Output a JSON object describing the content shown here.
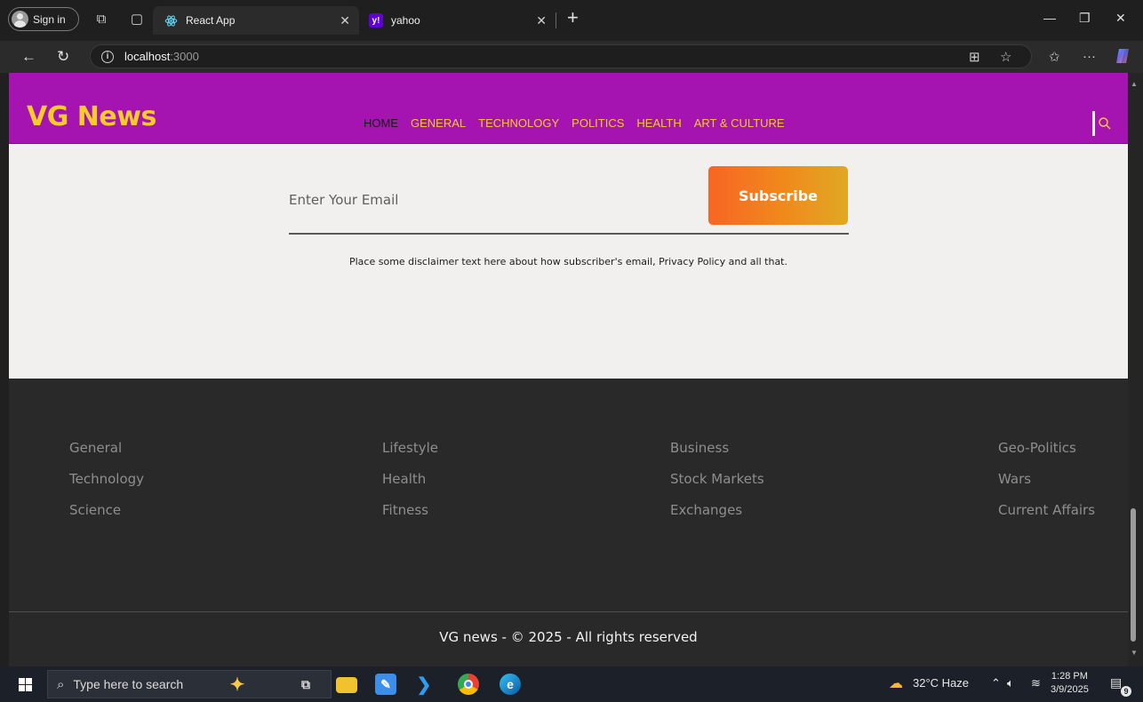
{
  "browser": {
    "profile_label": "Sign in",
    "tabs": [
      {
        "title": "React App",
        "active": true,
        "favicon": "react-icon"
      },
      {
        "title": "yahoo",
        "active": false,
        "favicon": "yahoo-icon"
      }
    ],
    "new_tab": "+",
    "url_host": "localhost",
    "url_port": ":3000"
  },
  "site": {
    "logo": "VG News",
    "nav": [
      "HOME",
      "GENERAL",
      "TECHNOLOGY",
      "POLITICS",
      "HEALTH",
      "ART & CULTURE"
    ],
    "active_nav": "HOME",
    "colors": {
      "header_bg": "#a513b0",
      "accent": "#f6cc2a",
      "footer_bg": "#2a2929"
    }
  },
  "subscribe": {
    "email_placeholder": "Enter Your Email",
    "button_label": "Subscribe",
    "disclaimer": "Place some disclaimer text here about how subscriber's email, Privacy Policy and all that."
  },
  "footer": {
    "columns": [
      [
        "General",
        "Technology",
        "Science"
      ],
      [
        "Lifestyle",
        "Health",
        "Fitness"
      ],
      [
        "Business",
        "Stock Markets",
        "Exchanges"
      ],
      [
        "Geo-Politics",
        "Wars",
        "Current Affairs"
      ]
    ],
    "copyright": "VG news - © 2025 - All rights reserved"
  },
  "taskbar": {
    "search_placeholder": "Type here to search",
    "weather": "32°C  Haze",
    "time": "1:28 PM",
    "date": "3/9/2025",
    "notifications": "9"
  }
}
